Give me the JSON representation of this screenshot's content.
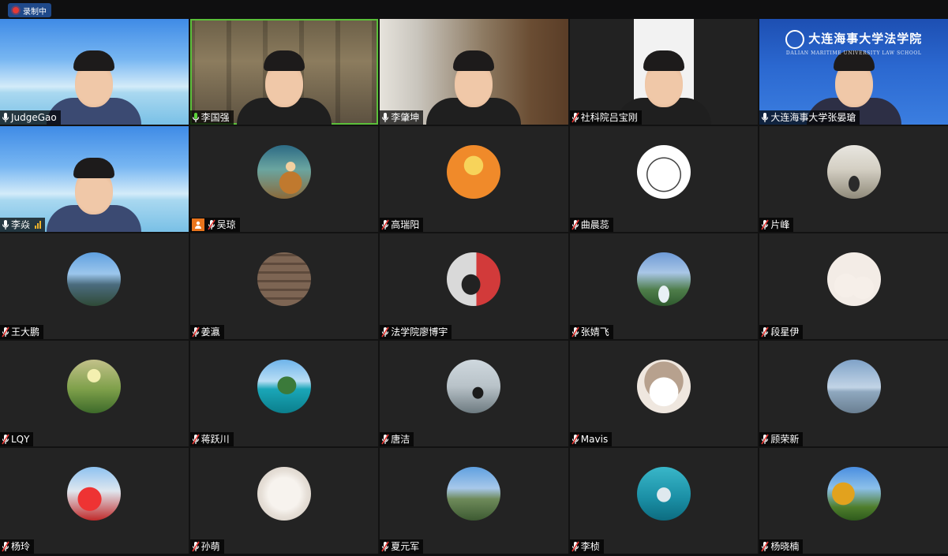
{
  "recording": {
    "label": "录制中"
  },
  "banner": {
    "title": "大连海事大学法学院",
    "subtitle": "DALIAN MARITIME UNIVERSITY LAW SCHOOL"
  },
  "participants": [
    {
      "name": "JudgeGao",
      "type": "video",
      "bg": "sky",
      "mic": "on"
    },
    {
      "name": "李国强",
      "type": "video",
      "bg": "shelf",
      "mic": "speaking",
      "speaking": true
    },
    {
      "name": "李肇坤",
      "type": "video",
      "bg": "room",
      "mic": "on"
    },
    {
      "name": "社科院吕宝刚",
      "type": "video",
      "bg": "gray",
      "mic": "muted"
    },
    {
      "name": "大连海事大学张晏瑲",
      "type": "video",
      "bg": "blue",
      "mic": "on"
    },
    {
      "name": "李焱",
      "type": "video",
      "bg": "sky",
      "mic": "on",
      "signal": true
    },
    {
      "name": "吴琼",
      "type": "avatar",
      "avatar": "person-street",
      "mic": "muted",
      "host": true
    },
    {
      "name": "高瑞阳",
      "type": "avatar",
      "avatar": "smiley",
      "mic": "muted"
    },
    {
      "name": "曲晨蕊",
      "type": "avatar",
      "avatar": "cartoon",
      "mic": "muted"
    },
    {
      "name": "片峰",
      "type": "avatar",
      "avatar": "field-person",
      "mic": "muted"
    },
    {
      "name": "王大鹏",
      "type": "avatar",
      "avatar": "city",
      "mic": "muted"
    },
    {
      "name": "姜瀛",
      "type": "avatar",
      "avatar": "mushroom",
      "mic": "muted"
    },
    {
      "name": "法学院廖博宇",
      "type": "avatar",
      "avatar": "red-person",
      "mic": "muted"
    },
    {
      "name": "张婧飞",
      "type": "avatar",
      "avatar": "fountain",
      "mic": "muted"
    },
    {
      "name": "段星伊",
      "type": "avatar",
      "avatar": "cat-sticker",
      "mic": "muted"
    },
    {
      "name": "LQY",
      "type": "avatar",
      "avatar": "grass",
      "mic": "muted"
    },
    {
      "name": "蒋跃川",
      "type": "avatar",
      "avatar": "island",
      "mic": "muted"
    },
    {
      "name": "唐洁",
      "type": "avatar",
      "avatar": "bridge",
      "mic": "muted"
    },
    {
      "name": "Mavis",
      "type": "avatar",
      "avatar": "anime",
      "mic": "muted"
    },
    {
      "name": "顾荣新",
      "type": "avatar",
      "avatar": "skyline",
      "mic": "muted"
    },
    {
      "name": "杨玲",
      "type": "avatar",
      "avatar": "red-group",
      "mic": "muted"
    },
    {
      "name": "孙萌",
      "type": "avatar",
      "avatar": "dog",
      "mic": "muted"
    },
    {
      "name": "夏元军",
      "type": "avatar",
      "avatar": "hill-city",
      "mic": "muted"
    },
    {
      "name": "李桢",
      "type": "avatar",
      "avatar": "dolphin",
      "mic": "muted"
    },
    {
      "name": "杨晓楠",
      "type": "avatar",
      "avatar": "autumn",
      "mic": "muted"
    }
  ]
}
